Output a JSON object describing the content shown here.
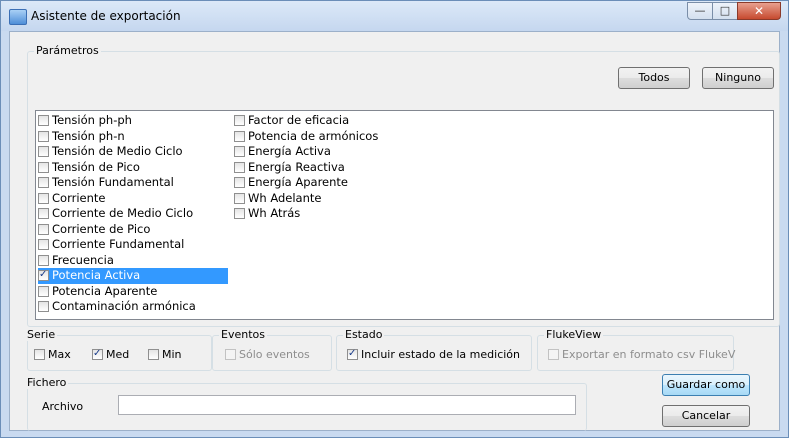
{
  "window": {
    "title": "Asistente de exportación",
    "minimize_glyph": "—",
    "maximize_glyph": "□",
    "close_glyph": "✕"
  },
  "params": {
    "legend": "Parámetros",
    "todos_label": "Todos",
    "ninguno_label": "Ninguno",
    "col1": [
      {
        "label": "Tensión ph-ph",
        "checked": false,
        "selected": false
      },
      {
        "label": "Tensión ph-n",
        "checked": false,
        "selected": false
      },
      {
        "label": "Tensión de Medio Ciclo",
        "checked": false,
        "selected": false
      },
      {
        "label": "Tensión de Pico",
        "checked": false,
        "selected": false
      },
      {
        "label": "Tensión Fundamental",
        "checked": false,
        "selected": false
      },
      {
        "label": "Corriente",
        "checked": false,
        "selected": false
      },
      {
        "label": "Corriente de Medio Ciclo",
        "checked": false,
        "selected": false
      },
      {
        "label": "Corriente de Pico",
        "checked": false,
        "selected": false
      },
      {
        "label": "Corriente Fundamental",
        "checked": false,
        "selected": false
      },
      {
        "label": "Frecuencia",
        "checked": false,
        "selected": false
      },
      {
        "label": "Potencia Activa",
        "checked": true,
        "selected": true
      },
      {
        "label": "Potencia Aparente",
        "checked": false,
        "selected": false
      },
      {
        "label": "Contaminación armónica",
        "checked": false,
        "selected": false
      }
    ],
    "col2": [
      {
        "label": "Factor de eficacia",
        "checked": false,
        "selected": false
      },
      {
        "label": "Potencia de armónicos",
        "checked": false,
        "selected": false
      },
      {
        "label": "Energía Activa",
        "checked": false,
        "selected": false
      },
      {
        "label": "Energía Reactiva",
        "checked": false,
        "selected": false
      },
      {
        "label": "Energía Aparente",
        "checked": false,
        "selected": false
      },
      {
        "label": "Wh Adelante",
        "checked": false,
        "selected": false
      },
      {
        "label": "Wh Atrás",
        "checked": false,
        "selected": false
      }
    ]
  },
  "serie": {
    "legend": "Serie",
    "max_label": "Max",
    "max_checked": false,
    "med_label": "Med",
    "med_checked": true,
    "min_label": "Min",
    "min_checked": false
  },
  "eventos": {
    "legend": "Eventos",
    "solo_label": "Sólo eventos",
    "solo_checked": false,
    "solo_enabled": false
  },
  "estado": {
    "legend": "Estado",
    "incluir_label": "Incluir estado de la medición",
    "incluir_checked": true
  },
  "flukeview": {
    "legend": "FlukeView",
    "exportar_label": "Exportar en formato csv FlukeV",
    "exportar_checked": false,
    "exportar_enabled": false
  },
  "fichero": {
    "legend": "Fichero",
    "archivo_label": "Archivo",
    "archivo_value": ""
  },
  "actions": {
    "guardar_label": "Guardar como",
    "cancelar_label": "Cancelar"
  },
  "colors": {
    "selection": "#3399ff",
    "title_bg": "#c5d7ef",
    "close_btn": "#c64a2f"
  }
}
